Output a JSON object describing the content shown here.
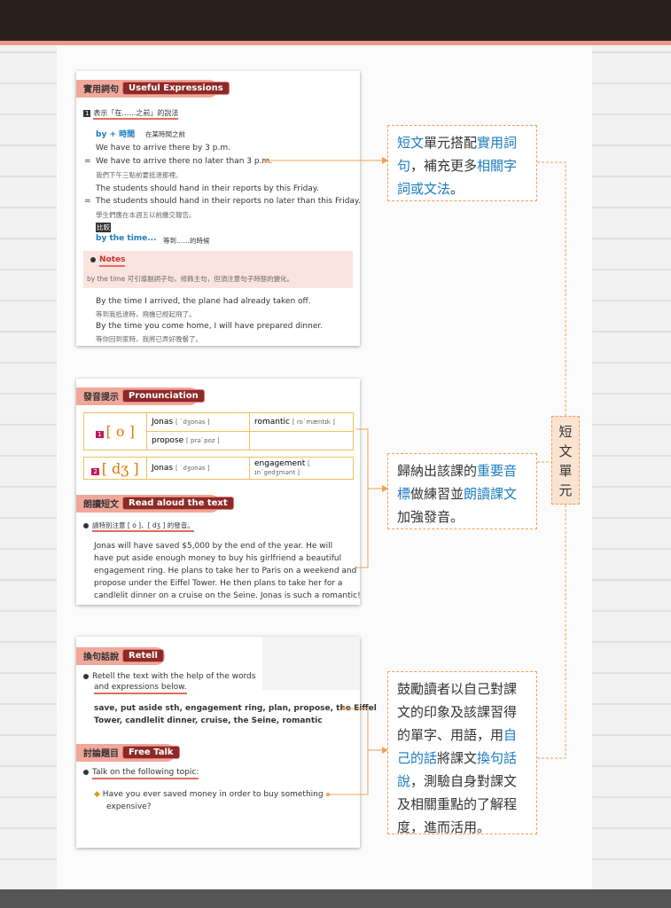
{
  "card1": {
    "header_zh": "實用詞句",
    "header_en": "Useful Expressions",
    "item_num": "1",
    "item_title": "表示「在……之前」的說法",
    "rule": "by + 時間",
    "rule_meaning": "在某時間之前",
    "ex1": "We have to arrive there by 3 p.m.",
    "ex2": "We have to arrive there no later than 3 p.m.",
    "ex2_eq": "=",
    "ex2_zh": "我們下午三點前要抵達那裡。",
    "ex3": "The students should hand in their reports by this Friday.",
    "ex4": "The students should hand in their reports no later than this Friday.",
    "ex4_eq": "=",
    "ex4_zh": "學生們應在本週五以前繳交報告。",
    "compare": "比較",
    "rule2": "by the time...",
    "rule2_meaning": "等到……的時候",
    "notes_label": "Notes",
    "notes_text": "by the time 可引導副詞子句，修飾主句，但須注意句子時態的變化。",
    "ex5": "By the time I arrived, the plane had already taken off.",
    "ex5_zh": "等到我抵達時，飛機已經起飛了。",
    "ex6": "By the time you come home, I will have prepared dinner.",
    "ex6_zh": "等你回到家時，我將已弄好晚餐了。"
  },
  "card2": {
    "header_zh": "發音提示",
    "header_en": "Pronunciation",
    "row1_num": "1",
    "row1_sym": "[ o ]",
    "row1_w1": "Jonas",
    "row1_w1_ipa": "[ ˋdʒonəs ]",
    "row1_w2": "romantic",
    "row1_w2_ipa": "[ roˋmæntɪk ]",
    "row1_w3": "propose",
    "row1_w3_ipa": "[ prəˋpoz ]",
    "row2_num": "2",
    "row2_sym": "[ dʒ ]",
    "row2_w1": "Jonas",
    "row2_w1_ipa": "[ ˋdʒonəs ]",
    "row2_w2": "engagement",
    "row2_w2_ipa": "[ ɪnˋgedʒmənt ]",
    "read_zh": "朗讀短文",
    "read_en": "Read aloud the text",
    "read_note": "請特別注意 [ o ]、[ dʒ ] 的發音。",
    "p1": "Jonas will have saved $5,000 by the end of the year. He will",
    "p2": "have put aside enough money to buy his girlfriend a beautiful",
    "p3": "engagement ring. He plans to take her to Paris on a weekend and",
    "p4": "propose under the Eiffel Tower. He then plans to take her for a",
    "p5": "candlelit dinner on a cruise on the Seine. Jonas is such a romantic!"
  },
  "card3": {
    "header_zh": "換句話說",
    "header_en": "Retell",
    "instr1": "Retell the text with the help of the words",
    "instr2": "and expressions below.",
    "words1": "save, put aside sth, engagement ring, plan, propose, the Eiffel",
    "words2": "Tower, candlelit dinner, cruise, the Seine, romantic",
    "talk_zh": "討論題目",
    "talk_en": "Free Talk",
    "talk_instr": "Talk on the following topic:",
    "q1": "Have you ever saved money in order to buy something",
    "q2": "expensive?"
  },
  "box1": {
    "l1a": "短文",
    "l1b": "單元搭配",
    "l1c": "實用詞",
    "l2a": "句",
    "l2b": "，補充更多",
    "l2c": "相關字",
    "l3a": "詞或文法",
    "l3b": "。"
  },
  "box2": {
    "l1a": "歸納出該課的",
    "l1b": "重要音",
    "l2a": "標",
    "l2b": "做練習並",
    "l2c": "朗讀課文",
    "l3": "加強發音。"
  },
  "box3": {
    "l1": "鼓勵讀者以自己對課",
    "l2": "文的印象及該課習得",
    "l3a": "的單字、用語，用",
    "l3b": "自",
    "l4a": "己的話",
    "l4b": "將課文",
    "l4c": "換句話",
    "l5a": "說",
    "l5b": "，測驗自身對課文",
    "l6": "及相關重點的了解程",
    "l7": "度，進而活用。"
  },
  "side_label": [
    "短",
    "文",
    "單",
    "元"
  ],
  "colors": {
    "accent_blue": "#1b7cc2",
    "pill": "#8c2a2a",
    "header_band": "#f1a89b",
    "dash": "#f0a057"
  }
}
